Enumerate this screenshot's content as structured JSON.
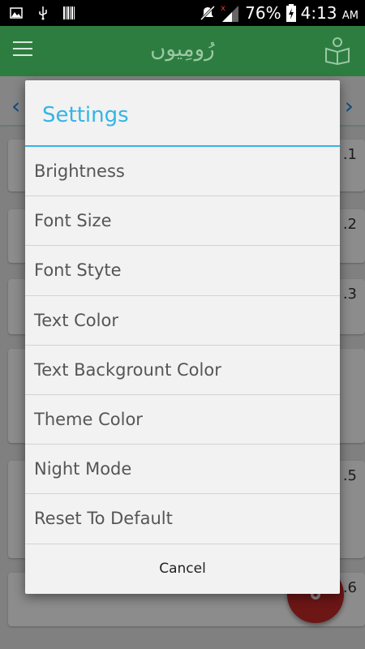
{
  "status_bar": {
    "battery": "76%",
    "time": "4:13",
    "ampm": "AM"
  },
  "app_bar": {
    "title": "رُومِیوں"
  },
  "background": {
    "verse_numbers": [
      ".1",
      ".2",
      ".3",
      ".5",
      ".6"
    ]
  },
  "dialog": {
    "title": "Settings",
    "options": [
      "Brightness",
      "Font Size",
      "Font Styte",
      "Text Color",
      "Text Backgrount Color",
      "Theme Color",
      "Night Mode",
      "Reset To Default"
    ],
    "cancel_label": "Cancel"
  },
  "colors": {
    "accent": "#33b5e5",
    "appbar": "#2e7d40",
    "fab": "#c62828"
  }
}
